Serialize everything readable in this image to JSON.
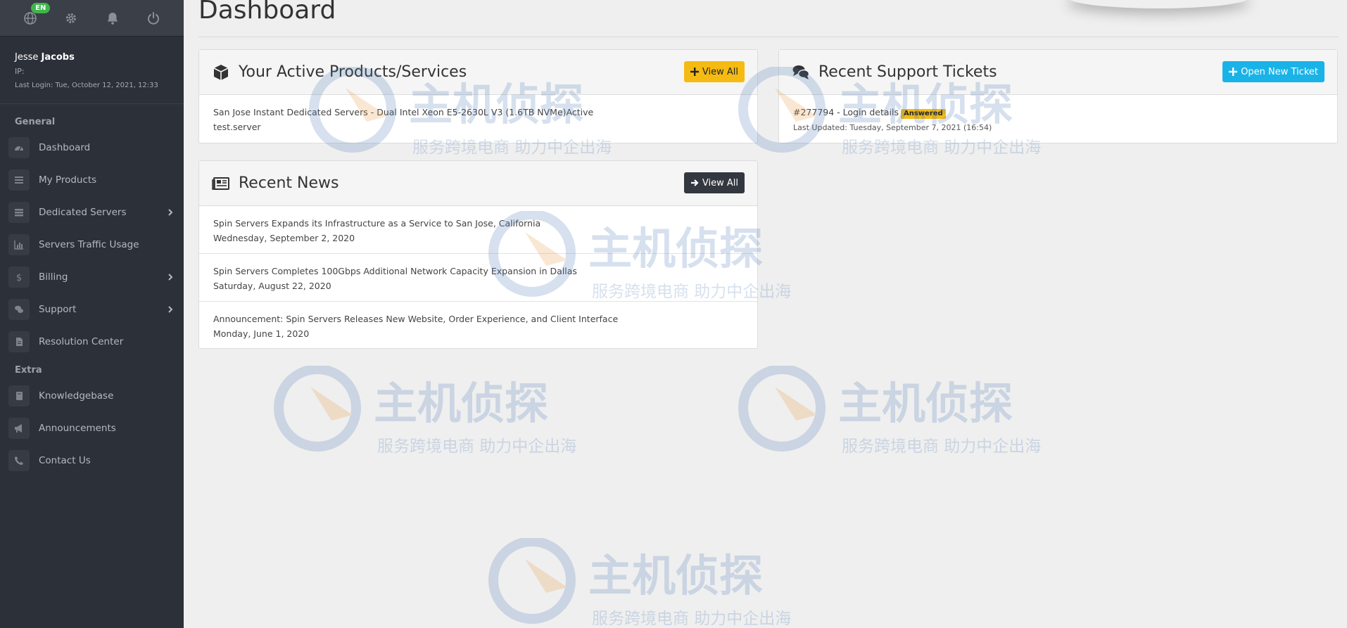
{
  "topbar": {
    "language_badge": "EN"
  },
  "user": {
    "first_name": "Jesse",
    "last_name": "Jacobs",
    "ip_label": "IP:",
    "last_login": "Last Login: Tue, October 12, 2021, 12:33"
  },
  "sidebar": {
    "general_heading": "General",
    "extra_heading": "Extra",
    "general_items": [
      {
        "label": "Dashboard"
      },
      {
        "label": "My Products"
      },
      {
        "label": "Dedicated Servers"
      },
      {
        "label": "Servers Traffic Usage"
      },
      {
        "label": "Billing"
      },
      {
        "label": "Support"
      },
      {
        "label": "Resolution Center"
      }
    ],
    "extra_items": [
      {
        "label": "Knowledgebase"
      },
      {
        "label": "Announcements"
      },
      {
        "label": "Contact Us"
      }
    ]
  },
  "page": {
    "title": "Dashboard"
  },
  "products": {
    "title": "Your Active Products/Services",
    "view_all": "View All",
    "items": [
      {
        "name": "San Jose Instant Dedicated Servers - Dual Intel Xeon E5-2630L V3 (1.6TB NVMe)",
        "status": "Active",
        "hostname": "test.server"
      }
    ]
  },
  "tickets": {
    "title": "Recent Support Tickets",
    "open_new": "Open New Ticket",
    "items": [
      {
        "subject": "#277794 - Login details",
        "status": "Answered",
        "updated": "Last Updated: Tuesday, September 7, 2021 (16:54)"
      }
    ]
  },
  "news": {
    "title": "Recent News",
    "view_all": "View All",
    "items": [
      {
        "title": "Spin Servers Expands its Infrastructure as a Service to San Jose, California",
        "date": "Wednesday, September 2, 2020"
      },
      {
        "title": "Spin Servers Completes 100Gbps Additional Network Capacity Expansion in Dallas",
        "date": "Saturday, August 22, 2020"
      },
      {
        "title": "Announcement: Spin Servers Releases New Website, Order Experience, and Client Interface",
        "date": "Monday, June 1, 2020"
      }
    ]
  },
  "watermark": {
    "brand": "主机侦探",
    "slogan": "服务跨境电商 助力中企出海"
  },
  "colors": {
    "sidebar_bg": "#2c3038",
    "accent_yellow": "#f5bb12",
    "accent_blue": "#1ab3e8",
    "dark_button": "#33373f"
  }
}
